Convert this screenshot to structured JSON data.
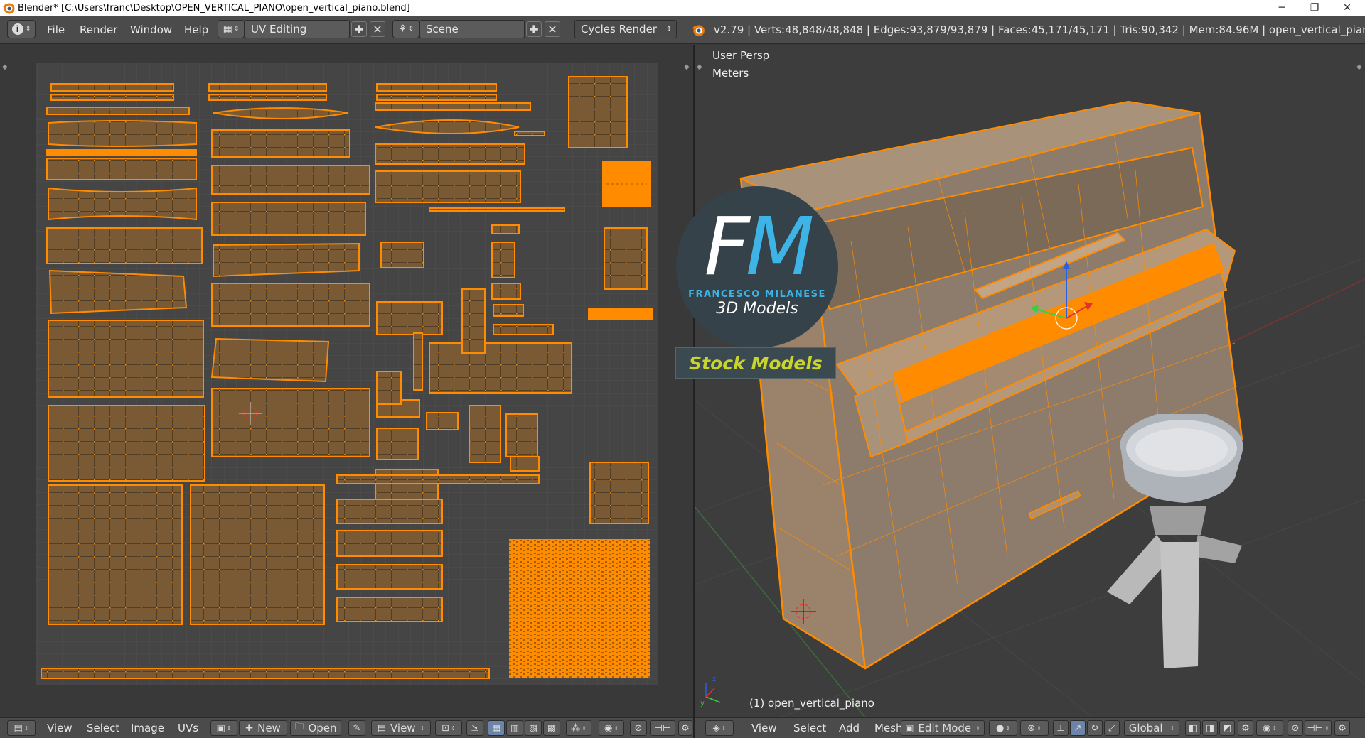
{
  "window": {
    "title": "Blender* [C:\\Users\\franc\\Desktop\\OPEN_VERTICAL_PIANO\\open_vertical_piano.blend]",
    "minimize": "─",
    "maximize": "❐",
    "close": "✕"
  },
  "topbar": {
    "menus": [
      "File",
      "Render",
      "Window",
      "Help"
    ],
    "screen_layout": "UV Editing",
    "scene": "Scene",
    "render_engine": "Cycles Render",
    "stats": "v2.79 | Verts:48,848/48,848 | Edges:93,879/93,879 | Faces:45,171/45,171 | Tris:90,342 | Mem:84.96M | open_vertical_piano"
  },
  "uv_editor": {
    "menus": [
      "View",
      "Select",
      "Image",
      "UVs"
    ],
    "new_label": "New",
    "open_label": "Open",
    "view_label": "View"
  },
  "viewport": {
    "view_name": "User Persp",
    "units": "Meters",
    "object_label": "(1) open_vertical_piano",
    "menus": [
      "View",
      "Select",
      "Add",
      "Mesh"
    ],
    "mode": "Edit Mode",
    "orientation": "Global"
  },
  "watermark": {
    "initials_f": "F",
    "initials_m": "M",
    "name": "FRANCESCO MILANESE",
    "tagline": "3D Models",
    "banner": "Stock Models"
  },
  "colors": {
    "accent_orange": "#ff8c00",
    "uv_fill": "#7a5a34",
    "logo_blue": "#3db4e5",
    "banner_yellow": "#c9d52a"
  }
}
